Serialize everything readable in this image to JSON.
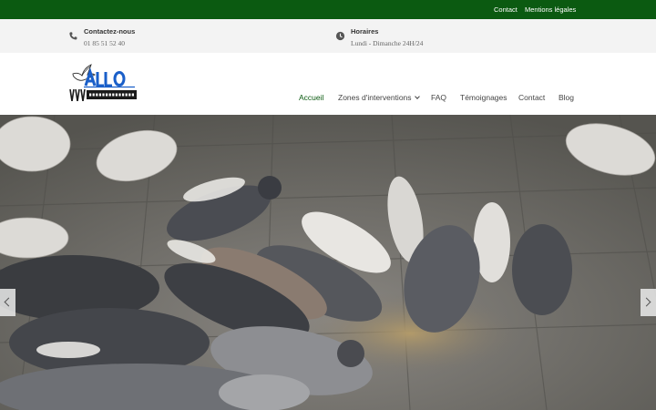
{
  "topbar": {
    "contact": "Contact",
    "mentions": "Mentions légales",
    "background": "#0b5a11"
  },
  "info": {
    "phone": {
      "title": "Contactez-nous",
      "value": "01 85 51 52 40",
      "icon": "phone-icon"
    },
    "hours": {
      "title": "Horaires",
      "value": "Lundi - Dimanche 24H/24",
      "icon": "clock-icon"
    }
  },
  "logo": {
    "text": "ALLO",
    "subtext": "DÉPIGEONNAGE",
    "accent": "#1a5fc9"
  },
  "nav": {
    "items": [
      {
        "label": "Accueil",
        "active": true
      },
      {
        "label": "Zones d'interventions",
        "dropdown": true
      },
      {
        "label": "FAQ"
      },
      {
        "label": "Témoignages"
      },
      {
        "label": "Contact"
      },
      {
        "label": "Blog"
      }
    ],
    "active_color": "#0b5a11"
  },
  "hero": {
    "image": "pigeons-feeding-on-pavement"
  },
  "slider": {
    "prev_icon": "chevron-left-icon",
    "next_icon": "chevron-right-icon"
  }
}
